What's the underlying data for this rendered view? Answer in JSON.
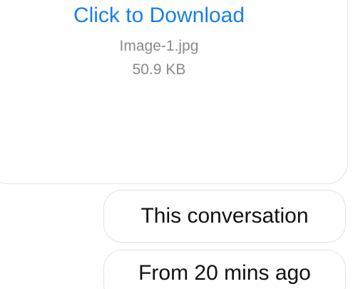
{
  "attachment": {
    "download_label": "Click to Download",
    "file_name": "Image-1.jpg",
    "file_size": "50.9 KB"
  },
  "filters": {
    "scope": "This conversation",
    "time": "From 20 mins ago"
  },
  "colors": {
    "link": "#1a7fe6",
    "meta_text": "#8a8a8a",
    "border": "#e3e3e3"
  }
}
